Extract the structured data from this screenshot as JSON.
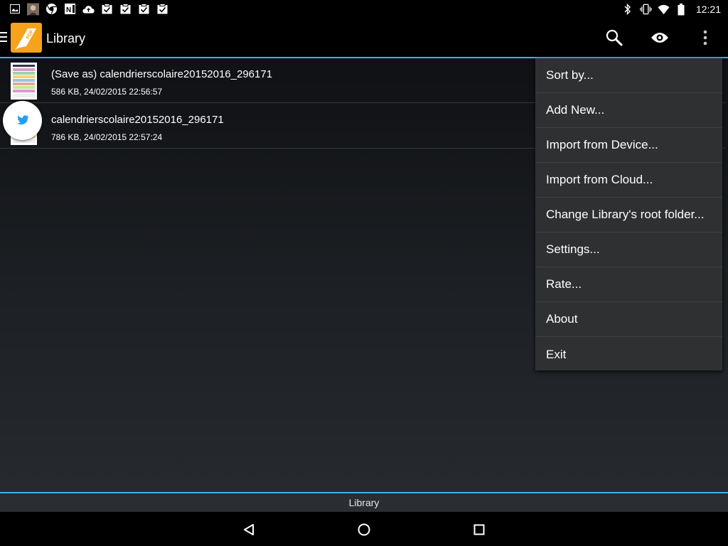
{
  "statusbar": {
    "time": "12:21",
    "left_icons": [
      "gallery-icon",
      "avatar",
      "chrome-icon",
      "onenote-icon",
      "cloud-upload-icon",
      "task-check-icon",
      "task-check-icon",
      "task-check-icon",
      "task-check-icon"
    ],
    "right_icons": [
      "bluetooth-icon",
      "vibrate-icon",
      "wifi-icon",
      "battery-icon"
    ]
  },
  "actionbar": {
    "title": "Library",
    "logo_text": "PDF",
    "actions": [
      "search-icon",
      "eye-icon",
      "overflow-menu-icon"
    ]
  },
  "library": {
    "files": [
      {
        "title": "(Save as) calendrierscolaire20152016_296171",
        "meta": "586 KB, 24/02/2015 22:56:57"
      },
      {
        "title": "calendrierscolaire20152016_296171",
        "meta": "786 KB, 24/02/2015 22:57:24"
      }
    ]
  },
  "menu": {
    "items": [
      "Sort by...",
      "Add New...",
      "Import from Device...",
      "Import from Cloud...",
      "Change Library's root folder...",
      "Settings...",
      "Rate...",
      "About",
      "Exit"
    ]
  },
  "bottom_tab": {
    "label": "Library"
  },
  "colors": {
    "accent": "#33b5e5",
    "logo": "#f7a21b",
    "menu_bg": "#2f3032",
    "twitter": "#1da1f2"
  }
}
